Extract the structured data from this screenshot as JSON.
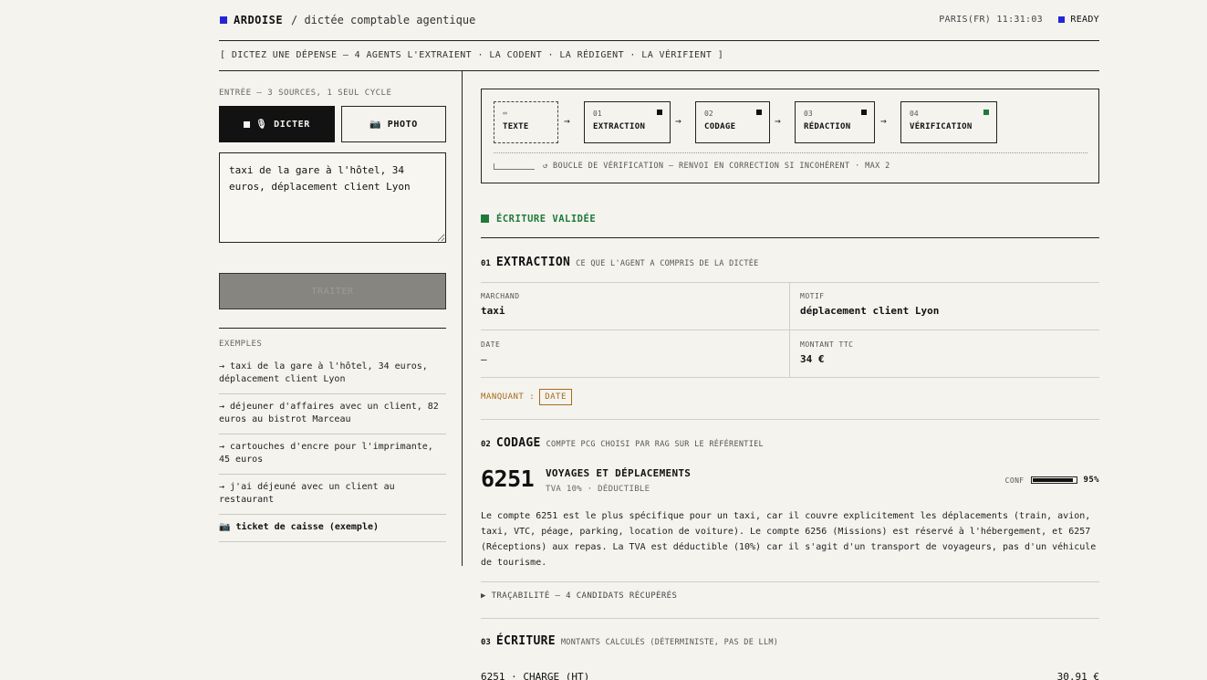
{
  "header": {
    "brand": "ARDOISE",
    "subtitle": "/ dictée comptable agentique",
    "clock": "PARIS(FR) 11:31:03",
    "status": "READY",
    "accent": "#2326d6"
  },
  "tagline": "[ DICTEZ UNE DÉPENSE — 4 AGENTS L'EXTRAIENT · LA CODENT · LA RÉDIGENT · LA VÉRIFIENT ]",
  "input": {
    "title": "ENTRÉE — 3 SOURCES, 1 SEUL CYCLE",
    "dictate_label": "🎙 DICTER",
    "photo_label": "📷 PHOTO",
    "text_value": "taxi de la gare à l'hôtel, 34 euros, déplacement client Lyon",
    "submit_label": "TRAITER"
  },
  "examples": {
    "title": "EXEMPLES",
    "items": [
      "→ taxi de la gare à l'hôtel, 34 euros, déplacement client Lyon",
      "→ déjeuner d'affaires avec un client, 82 euros au bistrot Marceau",
      "→ cartouches d'encre pour l'imprimante, 45 euros",
      "→ j'ai déjeuné avec un client au restaurant",
      "📷 ticket de caisse (exemple)"
    ]
  },
  "pipeline": {
    "steps": [
      {
        "num": "⌨",
        "label": "TEXTE"
      },
      {
        "num": "01",
        "label": "EXTRACTION"
      },
      {
        "num": "02",
        "label": "CODAGE"
      },
      {
        "num": "03",
        "label": "RÉDACTION"
      },
      {
        "num": "04",
        "label": "VÉRIFICATION"
      }
    ],
    "arrow": "→",
    "loop_text": "↺ BOUCLE DE VÉRIFICATION — RENVOI EN CORRECTION SI INCOHÉRENT · MAX 2"
  },
  "result": {
    "status": "ÉCRITURE VALIDÉE",
    "status_color": "#1f7a3a"
  },
  "extraction": {
    "num": "01",
    "title": "EXTRACTION",
    "desc": "CE QUE L'AGENT A COMPRIS DE LA DICTÉE",
    "fields": {
      "marchand_label": "MARCHAND",
      "marchand_value": "taxi",
      "motif_label": "MOTIF",
      "motif_value": "déplacement client Lyon",
      "date_label": "DATE",
      "date_value": "—",
      "montant_label": "MONTANT TTC",
      "montant_value": "34 €"
    },
    "missing_label": "MANQUANT :",
    "missing_badge": "DATE",
    "warning_color": "#a66b1a"
  },
  "codage": {
    "num": "02",
    "title": "CODAGE",
    "desc": "COMPTE PCG CHOISI PAR RAG SUR LE RÉFÉRENTIEL",
    "account": "6251",
    "account_title": "VOYAGES ET DÉPLACEMENTS",
    "account_sub": "TVA 10% · DÉDUCTIBLE",
    "conf_label": "CONF",
    "conf_value": 0.95,
    "conf_text": "95%",
    "explanation": "Le compte 6251 est le plus spécifique pour un taxi, car il couvre explicitement les déplacements (train, avion, taxi, VTC, péage, parking, location de voiture). Le compte 6256 (Missions) est réservé à l'hébergement, et 6257 (Réceptions) aux repas. La TVA est déductible (10%) car il s'agit d'un transport de voyageurs, pas d'un véhicule de tourisme.",
    "trace": "▶ TRAÇABILITÉ — 4 CANDIDATS RÉCUPÉRÉS"
  },
  "ecriture": {
    "num": "03",
    "title": "ÉCRITURE",
    "desc": "MONTANTS CALCULÉS (DÉTERMINISTE, PAS DE LLM)",
    "line_label": "6251 · CHARGE (HT)",
    "line_amount": "30,91 €"
  }
}
